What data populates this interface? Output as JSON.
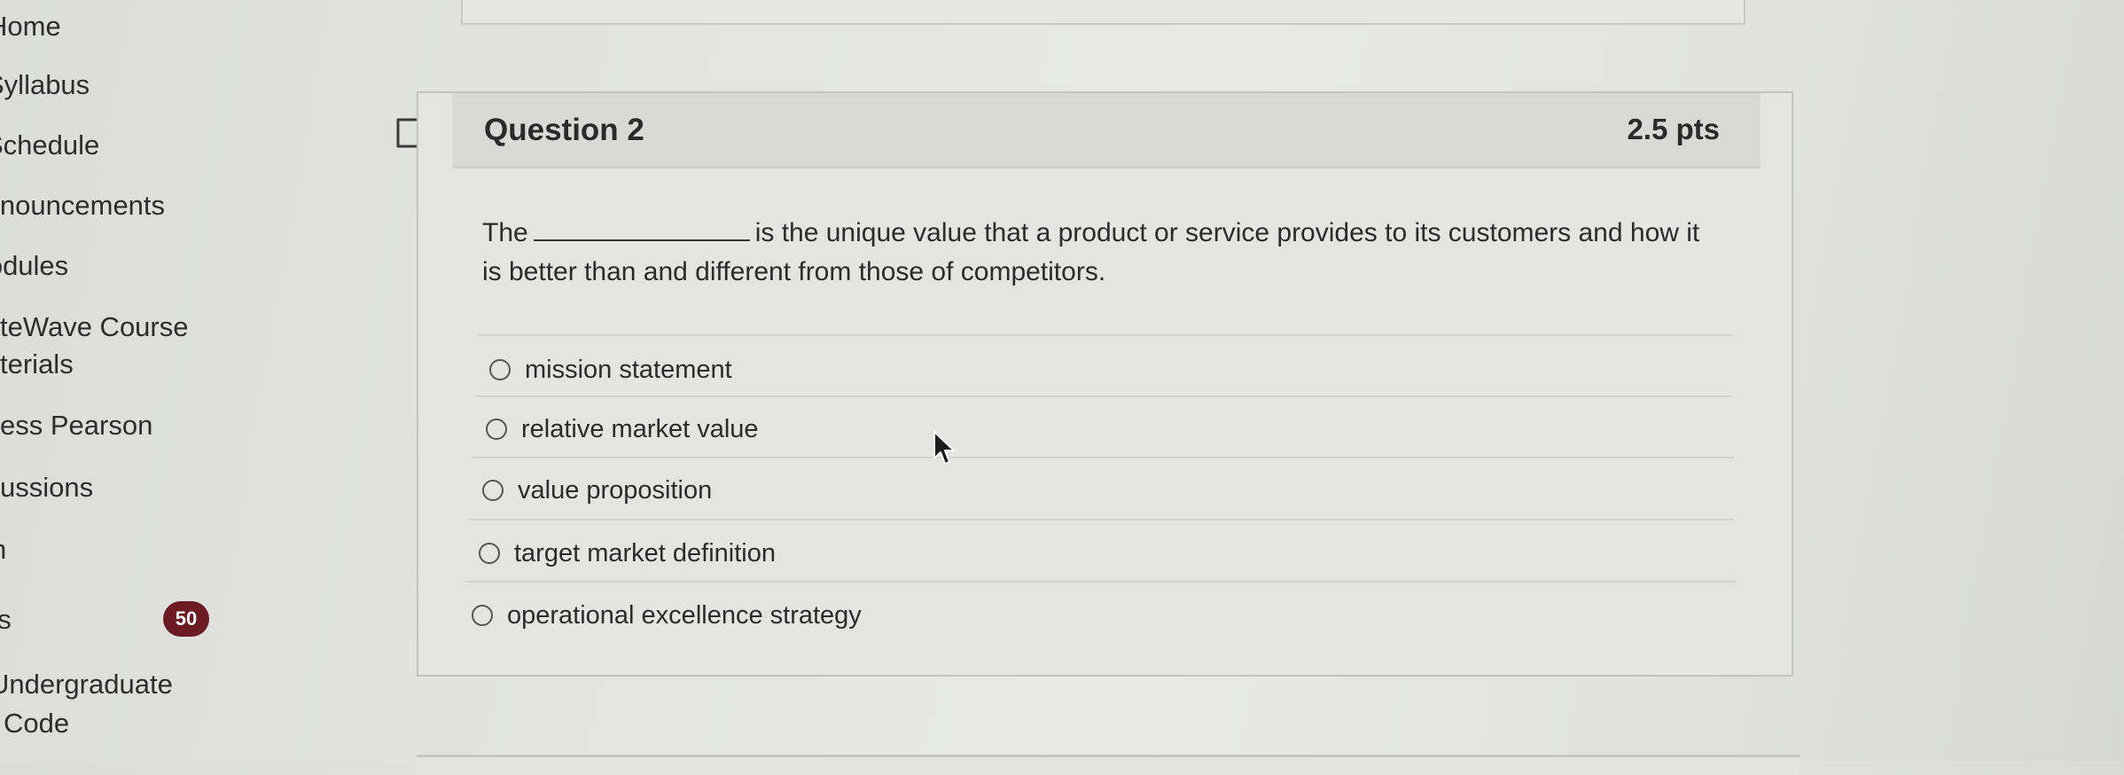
{
  "sidebar": {
    "items": [
      {
        "label": "Home"
      },
      {
        "label": "Syllabus"
      },
      {
        "label": "Schedule"
      },
      {
        "label": "Announcements"
      },
      {
        "label": "Modules"
      },
      {
        "label": "teWave Course"
      },
      {
        "label": "terials"
      },
      {
        "label": "ess Pearson"
      },
      {
        "label": "ussions"
      },
      {
        "label": "n"
      },
      {
        "label": "es"
      },
      {
        "label": "Undergraduate"
      },
      {
        "label": "Code"
      }
    ],
    "badge": "50"
  },
  "question": {
    "title": "Question 2",
    "points": "2.5 pts",
    "text_before": "The",
    "text_after": "is the unique value that a product or service provides to its customers and how it is better than and different from those of competitors.",
    "answers": [
      {
        "label": "mission statement"
      },
      {
        "label": "relative market value"
      },
      {
        "label": "value proposition"
      },
      {
        "label": "target market definition"
      },
      {
        "label": "operational excellence strategy"
      }
    ]
  },
  "icons": {
    "flag": "bookmark-flag-icon",
    "cursor": "mouse-pointer-icon"
  },
  "colors": {
    "badge": "#6c1a24",
    "header": "#d9dad8"
  }
}
